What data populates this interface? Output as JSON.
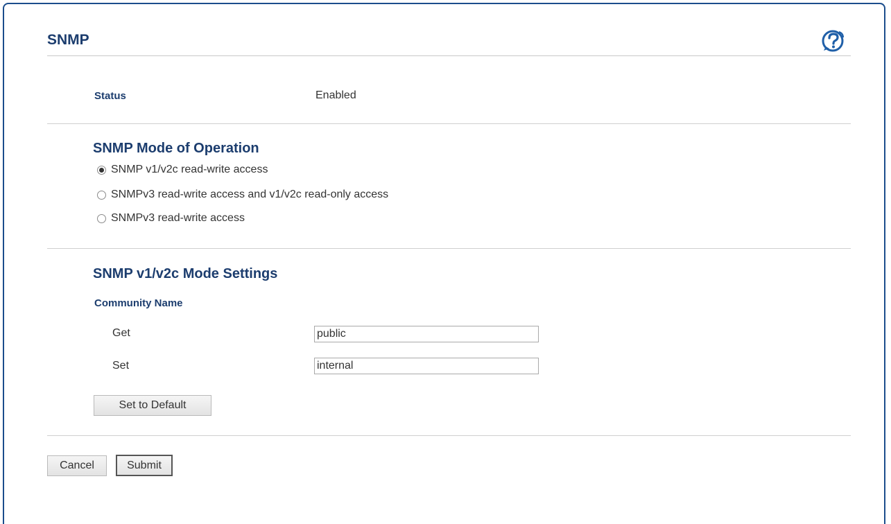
{
  "header": {
    "title": "SNMP"
  },
  "status": {
    "label": "Status",
    "value": "Enabled"
  },
  "mode": {
    "heading": "SNMP Mode of Operation",
    "options": [
      {
        "label": "SNMP v1/v2c read-write access",
        "selected": true
      },
      {
        "label": "SNMPv3 read-write access and v1/v2c read-only access",
        "selected": false
      },
      {
        "label": "SNMPv3 read-write access",
        "selected": false
      }
    ]
  },
  "settings": {
    "heading": "SNMP v1/v2c Mode Settings",
    "community_label": "Community Name",
    "get_label": "Get",
    "get_value": "public",
    "set_label": "Set",
    "set_value": "internal",
    "default_button": "Set to Default"
  },
  "footer": {
    "cancel": "Cancel",
    "submit": "Submit"
  },
  "colors": {
    "heading": "#1c3d6e",
    "border": "#1b4d8c",
    "help_icon": "#1f5fa8"
  },
  "icons": {
    "help": "help-icon"
  }
}
